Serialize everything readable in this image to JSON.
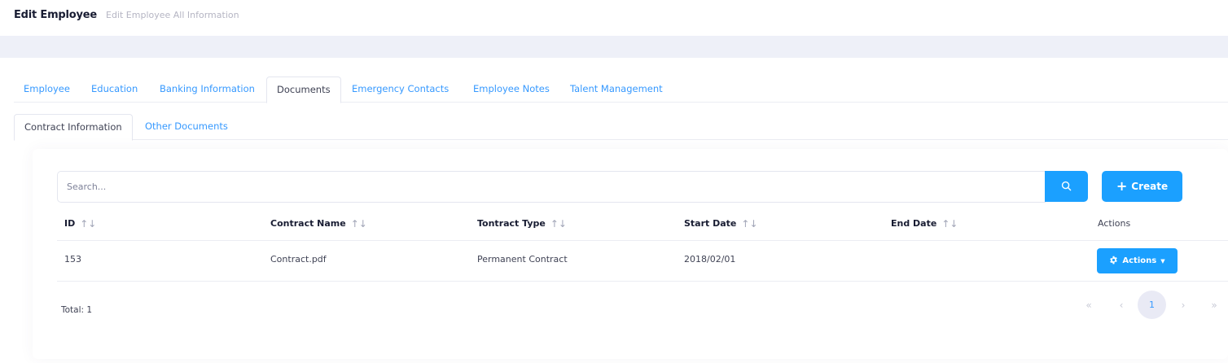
{
  "header": {
    "title": "Edit Employee",
    "description": "Edit Employee All Information"
  },
  "main_tabs": [
    {
      "label": "Employee",
      "active": false
    },
    {
      "label": "Education",
      "active": false
    },
    {
      "label": "Banking Information",
      "active": false
    },
    {
      "label": "Documents",
      "active": true
    },
    {
      "label": "Emergency Contacts",
      "active": false
    },
    {
      "label": "Employee Notes",
      "active": false
    },
    {
      "label": "Talent Management",
      "active": false
    }
  ],
  "sub_tabs": [
    {
      "label": "Contract Information",
      "active": true
    },
    {
      "label": "Other Documents",
      "active": false
    }
  ],
  "toolbar": {
    "search_placeholder": "Search...",
    "search_icon": "search-icon",
    "create_label": "Create",
    "create_icon": "plus-icon"
  },
  "table": {
    "columns": [
      "ID",
      "Contract Name",
      "Tontract Type",
      "Start Date",
      "End Date",
      "Actions"
    ],
    "rows": [
      {
        "id": "153",
        "contract_name": "Contract.pdf",
        "contract_type": "Permanent Contract",
        "start_date": "2018/02/01",
        "end_date": "",
        "action_label": "Actions"
      }
    ]
  },
  "footer": {
    "total_label": "Total: 1",
    "pagination": {
      "first": "«",
      "prev": "‹",
      "current_page": "1",
      "next": "›",
      "last": "»"
    }
  },
  "colors": {
    "primary": "#1ba0ff",
    "link": "#3699ff",
    "band": "#eef0f8"
  }
}
